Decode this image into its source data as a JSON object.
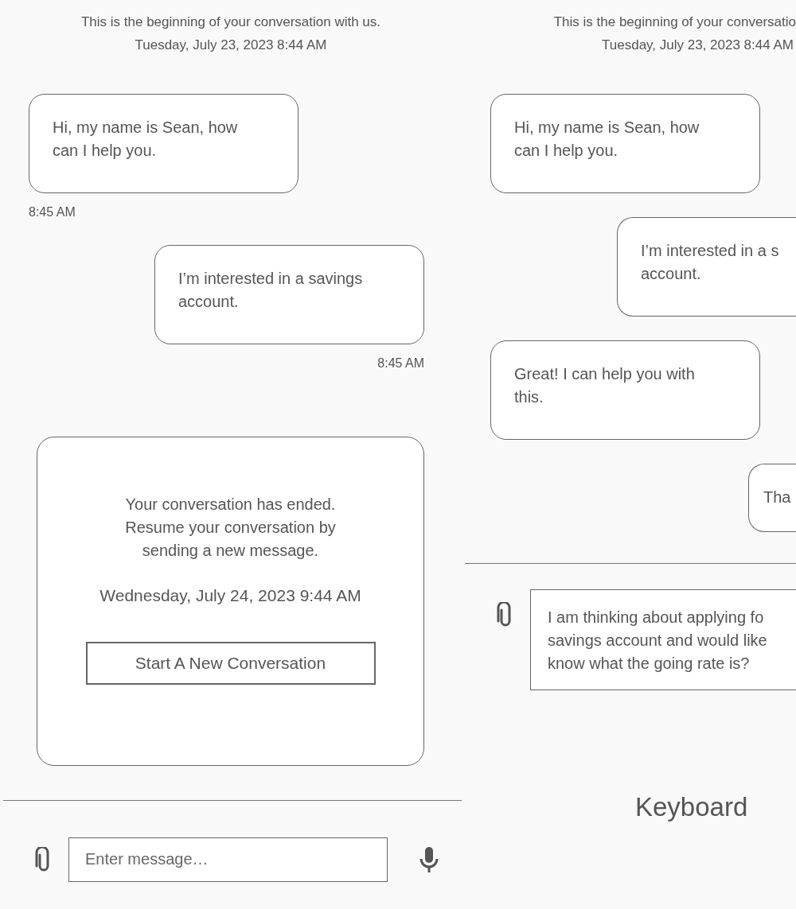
{
  "screens": [
    {
      "header": {
        "intro": "This is the beginning of your conversation with us.",
        "date": "Tuesday, July 23, 2023 8:44 AM"
      },
      "messages": [
        {
          "kind": "agent",
          "text": "Hi, my name is Sean, how\ncan I help you.",
          "time": "8:45 AM"
        },
        {
          "kind": "user",
          "text": "I’m interested in a savings\naccount.",
          "time": "8:45 AM"
        }
      ],
      "ended_card": {
        "message": "Your conversation has ended.\nResume your conversation by\nsending a new message.",
        "date": "Wednesday, July 24, 2023 9:44 AM",
        "button": "Start A New Conversation"
      },
      "composer": {
        "placeholder": "Enter message…"
      }
    },
    {
      "header": {
        "intro": "This is the beginning of your conversatio",
        "date": "Tuesday, July 23, 2023 8:44 AM"
      },
      "messages": [
        {
          "kind": "agent",
          "text": "Hi, my name is Sean, how\ncan I help you."
        },
        {
          "kind": "user",
          "text": "I’m interested in a s\naccount."
        },
        {
          "kind": "agent",
          "text": "Great! I can help you with\nthis."
        },
        {
          "kind": "user",
          "text": "Tha"
        }
      ],
      "composer": {
        "value": "I am thinking about applying fo\nsavings account and would like\nknow what the going rate is?"
      },
      "keyboard_label": "Keyboard"
    }
  ]
}
